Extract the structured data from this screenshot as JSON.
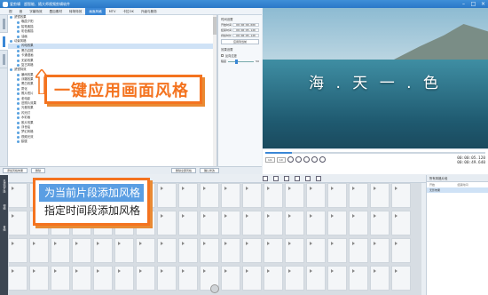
{
  "titlebar": {
    "app": "爱剪辑",
    "subtitle": "超智能、随大师视频剪辑软件"
  },
  "menu": {
    "items": [
      "视",
      "音",
      "字幕特效",
      "叠加素材",
      "转场特效",
      "画面风格",
      "MTV",
      "卡拉OK",
      "升级与服务"
    ],
    "active_index": 5
  },
  "tree": {
    "items": [
      {
        "label": "滤镜效果",
        "level": 0
      },
      {
        "label": "晚霞夕阳",
        "level": 1
      },
      {
        "label": "铅笔素描",
        "level": 1
      },
      {
        "label": "彩色素描",
        "level": 1
      },
      {
        "label": "油画",
        "level": 1
      },
      {
        "label": "动景风格",
        "level": 0
      },
      {
        "label": "闪电效果",
        "level": 1
      },
      {
        "label": "黑白边框",
        "level": 1
      },
      {
        "label": "卡通漫画",
        "level": 1
      },
      {
        "label": "无影效果",
        "level": 1
      },
      {
        "label": "复古风格",
        "level": 1
      },
      {
        "label": "滤镜特效",
        "level": 0
      },
      {
        "label": "暴雨效果",
        "level": 1
      },
      {
        "label": "浮雕效果",
        "level": 1
      },
      {
        "label": "黑白效果",
        "level": 1
      },
      {
        "label": "雾化",
        "level": 1
      },
      {
        "label": "照片底片",
        "level": 1
      },
      {
        "label": "老电影",
        "level": 1
      },
      {
        "label": "旧照片效果",
        "level": 1
      },
      {
        "label": "光晕效果",
        "level": 1
      },
      {
        "label": "闪光灯",
        "level": 1
      },
      {
        "label": "水彩画",
        "level": 1
      },
      {
        "label": "胶片效果",
        "level": 1
      },
      {
        "label": "浮世绘",
        "level": 1
      },
      {
        "label": "梦幻风格",
        "level": 1
      },
      {
        "label": "视频光效",
        "level": 1
      },
      {
        "label": "朦胧",
        "level": 1
      }
    ],
    "selected_index": 6
  },
  "time_panel": {
    "title": "时间设置",
    "rows": [
      {
        "label": "开始时间",
        "value": "00:00:00.000"
      },
      {
        "label": "结束时间",
        "value": "00:00:05.120"
      },
      {
        "label": "持续时长",
        "value": "00:00:05.120"
      }
    ],
    "apply_label": "应用到当前",
    "effect_title": "效果设置",
    "checkbox_label": "反向过渡",
    "degree_label": "程度",
    "degree_value": "50"
  },
  "fx_buttons": {
    "add": "添加风格效果",
    "remove": "删除",
    "clear": "删除全部风格",
    "confirm": "确认修改"
  },
  "preview": {
    "caption": "海 . 天 一 . 色"
  },
  "player": {
    "progress": 0.12,
    "speed_box": "1/1",
    "scale_box": "1X",
    "current_time": "00:00:05.120",
    "total_time": "00:00:49.640"
  },
  "timeline_toolbar": {
    "export_label": "导出视频"
  },
  "timeline_left": {
    "tabs": [
      "已添加片段",
      "视频",
      "音频"
    ]
  },
  "rpanel": {
    "title": "所有风格片段",
    "col_start": "开始",
    "col_end": "结束时间",
    "selected_label": "无影效果"
  },
  "callout1": {
    "text": "一键应用画面风格"
  },
  "callout2": {
    "options": [
      "为当前片段添加风格",
      "指定时间段添加风格"
    ],
    "highlighted_index": 0
  },
  "colors": {
    "accent": "#3a87d6",
    "callout": "#f4731f",
    "highlight": "#5a9ee3"
  }
}
